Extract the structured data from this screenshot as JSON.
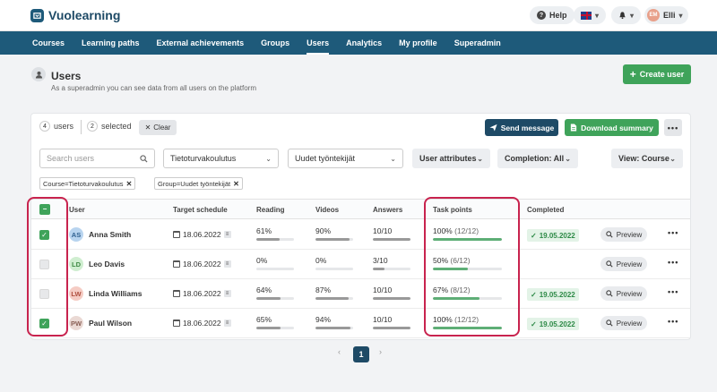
{
  "app": {
    "name": "Vuolearning",
    "help_label": "Help",
    "user_initials": "EM",
    "user_name": "Elli"
  },
  "nav": [
    "Courses",
    "Learning paths",
    "External achievements",
    "Groups",
    "Users",
    "Analytics",
    "My profile",
    "Superadmin"
  ],
  "nav_active": "Users",
  "header": {
    "title": "Users",
    "subtitle": "As a superadmin you can see data from all users on the platform",
    "create_label": "Create user"
  },
  "toolbar": {
    "users_count": "4",
    "users_label": "users",
    "selected_count": "2",
    "selected_label": "selected",
    "clear_label": "Clear",
    "send_label": "Send message",
    "download_label": "Download summary",
    "more_label": "•••"
  },
  "filters": {
    "search_placeholder": "Search users",
    "course": "Tietoturvakoulutus",
    "group": "Uudet työntekijät",
    "attributes": "User attributes",
    "completion_label": "Completion:",
    "completion_value": "All",
    "view_label": "View:",
    "view_value": "Course"
  },
  "tags": [
    "Course=Tietoturvakoulutus",
    "Group=Uudet työntekijät"
  ],
  "columns": {
    "user": "User",
    "target": "Target schedule",
    "reading": "Reading",
    "videos": "Videos",
    "answers": "Answers",
    "task_points": "Task points",
    "completed": "Completed"
  },
  "rows": [
    {
      "checked": true,
      "initials": "AS",
      "name": "Anna Smith",
      "target": "18.06.2022",
      "reading": "61%",
      "reading_pct": 61,
      "videos": "90%",
      "videos_pct": 90,
      "answers": "10/10",
      "answers_pct": 100,
      "task_points": "100%",
      "task_detail": "(12/12)",
      "task_pct": 100,
      "completed": "19.05.2022",
      "preview": "Preview",
      "more": "•••"
    },
    {
      "checked": false,
      "initials": "LD",
      "name": "Leo Davis",
      "target": "18.06.2022",
      "reading": "0%",
      "reading_pct": 0,
      "videos": "0%",
      "videos_pct": 0,
      "answers": "3/10",
      "answers_pct": 30,
      "task_points": "50%",
      "task_detail": "(6/12)",
      "task_pct": 50,
      "completed": "",
      "preview": "Preview",
      "more": "•••"
    },
    {
      "checked": false,
      "initials": "LW",
      "name": "Linda Williams",
      "target": "18.06.2022",
      "reading": "64%",
      "reading_pct": 64,
      "videos": "87%",
      "videos_pct": 87,
      "answers": "10/10",
      "answers_pct": 100,
      "task_points": "67%",
      "task_detail": "(8/12)",
      "task_pct": 67,
      "completed": "19.05.2022",
      "preview": "Preview",
      "more": "•••"
    },
    {
      "checked": true,
      "initials": "PW",
      "name": "Paul Wilson",
      "target": "18.06.2022",
      "reading": "65%",
      "reading_pct": 65,
      "videos": "94%",
      "videos_pct": 94,
      "answers": "10/10",
      "answers_pct": 100,
      "task_points": "100%",
      "task_detail": "(12/12)",
      "task_pct": 100,
      "completed": "19.05.2022",
      "preview": "Preview",
      "more": "•••"
    }
  ],
  "pagination": {
    "current": "1",
    "prev": "‹",
    "next": "›"
  },
  "colors": {
    "brand": "#1e5a7a",
    "green": "#3fa35a",
    "highlight": "#c8234e"
  }
}
